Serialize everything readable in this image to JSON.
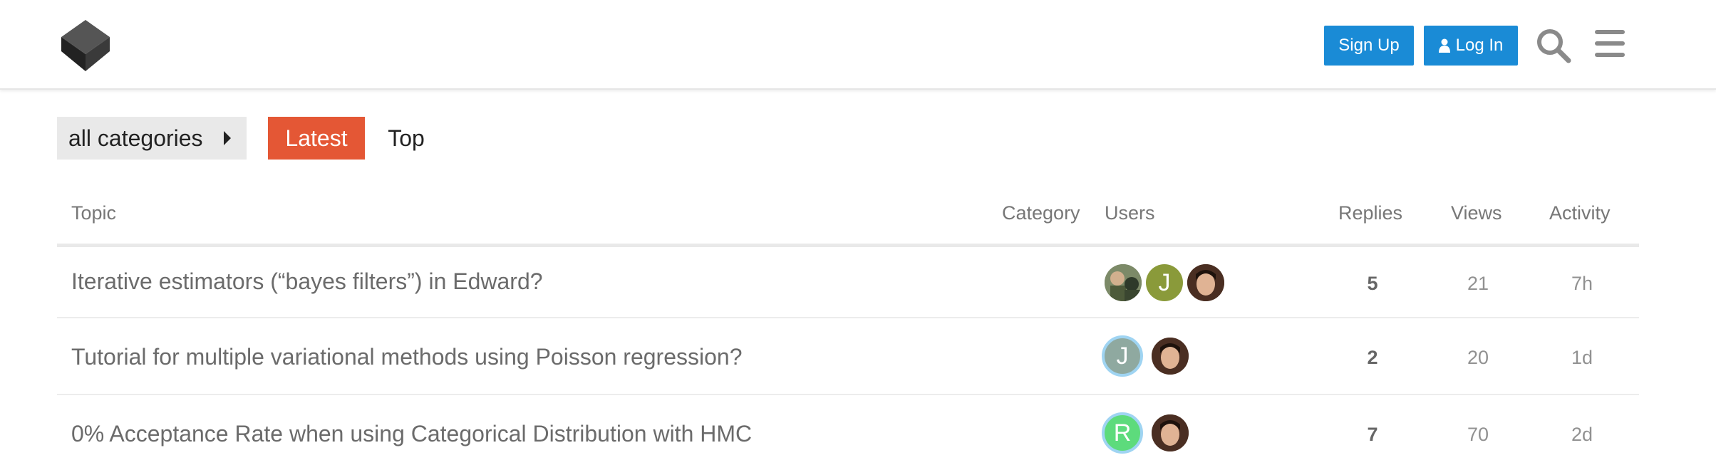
{
  "header": {
    "signup_label": "Sign Up",
    "login_label": "Log In",
    "accent_color": "#1a8bd6"
  },
  "nav": {
    "category_dropdown": "all categories",
    "tabs": [
      {
        "label": "Latest",
        "active": true,
        "color": "#e45735"
      },
      {
        "label": "Top",
        "active": false
      }
    ]
  },
  "table": {
    "columns": [
      "Topic",
      "Category",
      "Users",
      "Replies",
      "Views",
      "Activity"
    ],
    "rows": [
      {
        "title": "Iterative estimators (“bayes filters”) in Edward?",
        "users": [
          {
            "initial": "",
            "color": "#6b7a55",
            "kind": "photo-group"
          },
          {
            "initial": "J",
            "color": "#8a9a3a",
            "kind": "letter"
          },
          {
            "initial": "",
            "color": "#5a3a2a",
            "kind": "photo-face"
          }
        ],
        "replies": "5",
        "views": "21",
        "activity": "7h"
      },
      {
        "title": "Tutorial for multiple variational methods using Poisson regression?",
        "users": [
          {
            "initial": "J",
            "color": "#8fa9a0",
            "kind": "letter",
            "ring": "#9fd4f2"
          },
          {
            "initial": "",
            "color": "#5a3a2a",
            "kind": "photo-face"
          }
        ],
        "replies": "2",
        "views": "20",
        "activity": "1d"
      },
      {
        "title": "0% Acceptance Rate when using Categorical Distribution with HMC",
        "users": [
          {
            "initial": "R",
            "color": "#5ddb7c",
            "kind": "letter",
            "ring": "#9fd4f2"
          },
          {
            "initial": "",
            "color": "#5a3a2a",
            "kind": "photo-face"
          }
        ],
        "replies": "7",
        "views": "70",
        "activity": "2d"
      }
    ]
  }
}
